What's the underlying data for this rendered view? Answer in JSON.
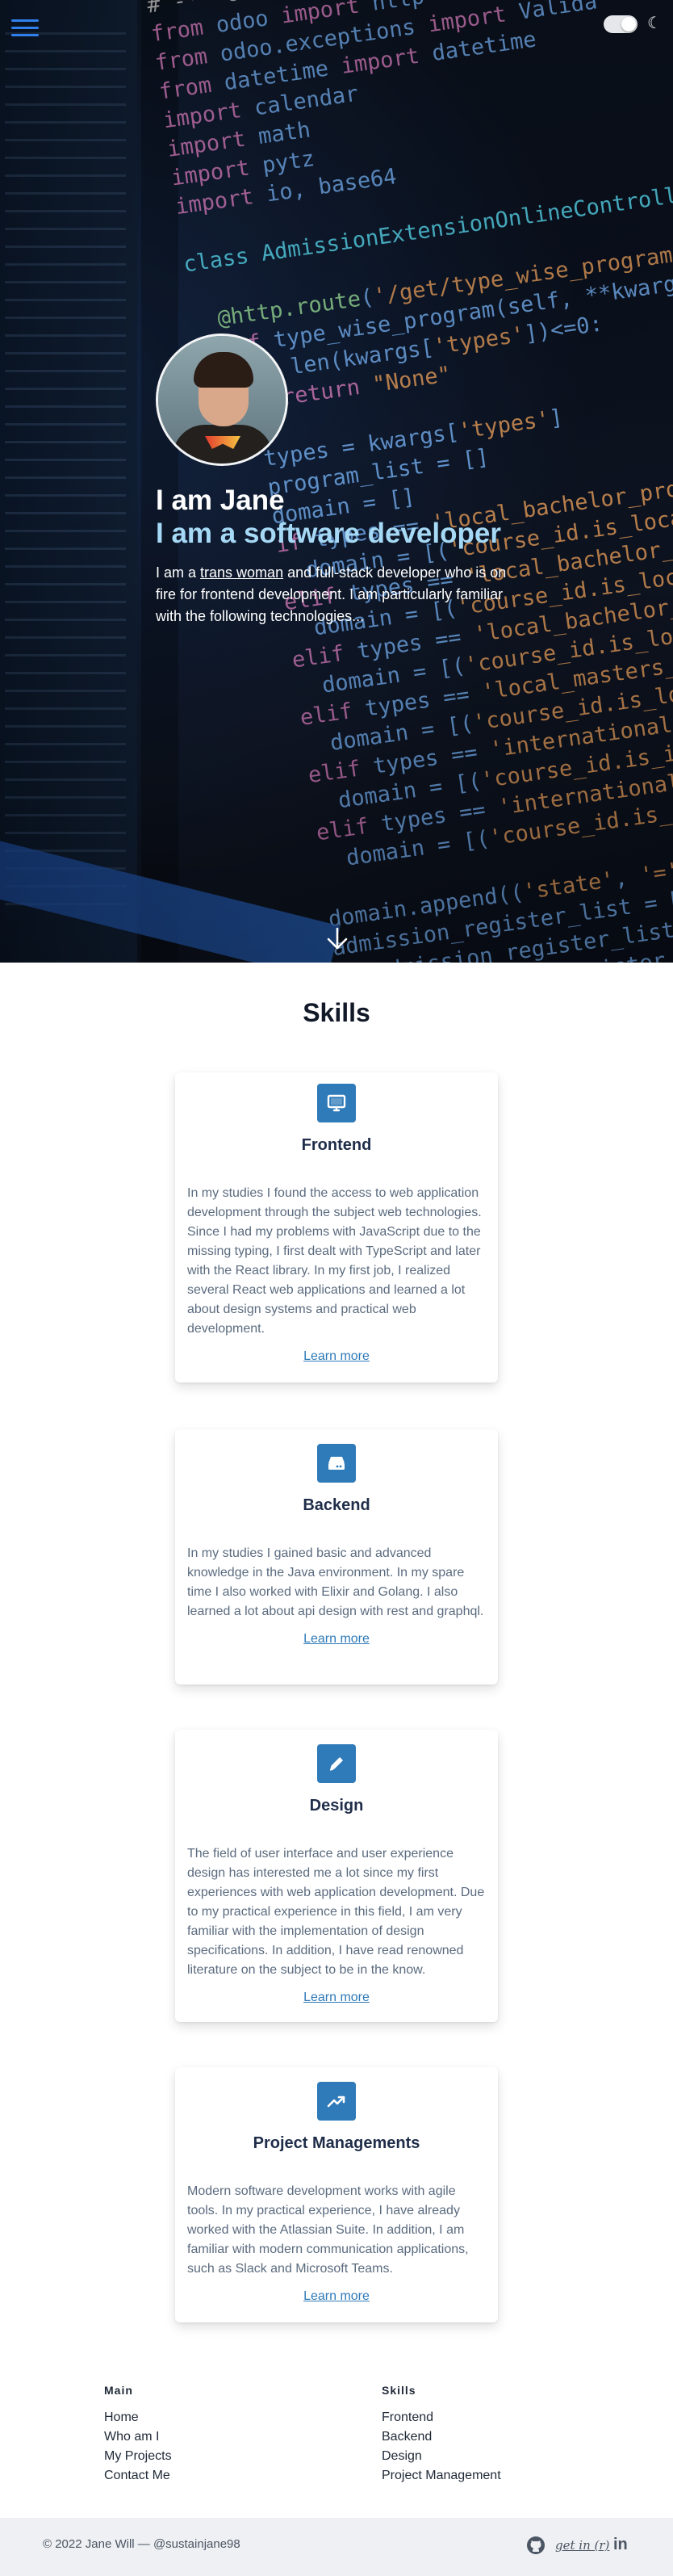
{
  "hero": {
    "name": "I am Jane",
    "role": "I am a software developer",
    "intro_before": "I am a ",
    "intro_link": "trans woman",
    "intro_after": " and full-stack developer who is on fire for frontend development. I am particularly familiar with the following technologies..."
  },
  "skills": {
    "title": "Skills",
    "cards": [
      {
        "icon": "monitor-icon",
        "title": "Frontend",
        "text": "In my studies I found the access to web application development through the subject web technologies. Since I had my problems with JavaScript due to the missing typing, I first dealt with TypeScript and later with the React library. In my first job, I realized several React web applications and learned a lot about design systems and practical web development.",
        "link": "Learn more"
      },
      {
        "icon": "server-icon",
        "title": "Backend",
        "text": "In my studies I gained basic and advanced knowledge in the Java environment. In my spare time I also worked with Elixir and Golang. I also learned a lot about api design with rest and graphql.",
        "link": "Learn more"
      },
      {
        "icon": "pencil-icon",
        "title": "Design",
        "text": "The field of user interface and user experience design has interested me a lot since my first experiences with web application development. Due to my practical experience in this field, I am very familiar with the implementation of design specifications. In addition, I have read renowned literature on the subject to be in the know.",
        "link": "Learn more"
      },
      {
        "icon": "trending-up-icon",
        "title": "Project Managements",
        "text": "Modern software development works with agile tools. In my practical experience, I have already worked with the Atlassian Suite. In addition, I am familiar with modern communication applications, such as Slack and Microsoft Teams.",
        "link": "Learn more"
      }
    ]
  },
  "footer": {
    "main_heading": "Main",
    "main_links": [
      "Home",
      "Who am I",
      "My Projects",
      "Contact Me"
    ],
    "skills_heading": "Skills",
    "skills_links": [
      "Frontend",
      "Backend",
      "Design",
      "Project Management"
    ],
    "copyright": "© 2022 Jane Will — @sustainjane98",
    "social_getin": "get in (r)",
    "social_linkedin": "in"
  },
  "colors": {
    "accent": "#2f7ab8",
    "role_text": "#a6d9f5",
    "bottom_bar": "#eef0f3"
  }
}
